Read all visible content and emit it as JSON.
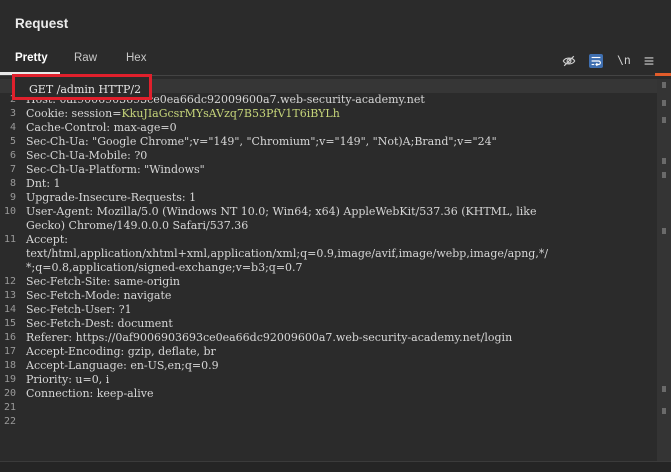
{
  "panel": {
    "title": "Request",
    "tabs": [
      {
        "label": "Pretty",
        "active": true
      },
      {
        "label": "Raw",
        "active": false
      },
      {
        "label": "Hex",
        "active": false
      }
    ],
    "toolbar": {
      "hide_icon": "eye-off-icon",
      "wrap_icon": "wrap-lines-icon",
      "newline_label": "\\n",
      "menu_icon": "hamburger-menu-icon"
    },
    "accent_color": "#e25c2a",
    "highlight_color": "#e0202c"
  },
  "request": {
    "highlighted_first_line": "GET /admin HTTP/2",
    "lines": [
      {
        "n": "1",
        "text": ""
      },
      {
        "n": "2",
        "text": "Host: 0af9006903693ce0ea66dc92009600a7.web-security-academy.net"
      },
      {
        "n": "3",
        "text": "Cookie: session=",
        "green": "KkuJIaGcsrMYsAVzq7B53PfV1T6iBYLh"
      },
      {
        "n": "4",
        "text": "Cache-Control: max-age=0"
      },
      {
        "n": "5",
        "text": "Sec-Ch-Ua: \"Google Chrome\";v=\"149\", \"Chromium\";v=\"149\", \"Not)A;Brand\";v=\"24\""
      },
      {
        "n": "6",
        "text": "Sec-Ch-Ua-Mobile: ?0"
      },
      {
        "n": "7",
        "text": "Sec-Ch-Ua-Platform: \"Windows\""
      },
      {
        "n": "8",
        "text": "Dnt: 1"
      },
      {
        "n": "9",
        "text": "Upgrade-Insecure-Requests: 1"
      },
      {
        "n": "10",
        "text": "User-Agent: Mozilla/5.0 (Windows NT 10.0; Win64; x64) AppleWebKit/537.36 (KHTML, like"
      },
      {
        "n": "",
        "text": "Gecko) Chrome/149.0.0.0 Safari/537.36"
      },
      {
        "n": "11",
        "text": "Accept:"
      },
      {
        "n": "",
        "text": "text/html,application/xhtml+xml,application/xml;q=0.9,image/avif,image/webp,image/apng,*/"
      },
      {
        "n": "",
        "text": "*;q=0.8,application/signed-exchange;v=b3;q=0.7"
      },
      {
        "n": "12",
        "text": "Sec-Fetch-Site: same-origin"
      },
      {
        "n": "13",
        "text": "Sec-Fetch-Mode: navigate"
      },
      {
        "n": "14",
        "text": "Sec-Fetch-User: ?1"
      },
      {
        "n": "15",
        "text": "Sec-Fetch-Dest: document"
      },
      {
        "n": "16",
        "text": "Referer: https://0af9006903693ce0ea66dc92009600a7.web-security-academy.net/login"
      },
      {
        "n": "17",
        "text": "Accept-Encoding: gzip, deflate, br"
      },
      {
        "n": "18",
        "text": "Accept-Language: en-US,en;q=0.9"
      },
      {
        "n": "19",
        "text": "Priority: u=0, i"
      },
      {
        "n": "20",
        "text": "Connection: keep-alive"
      },
      {
        "n": "21",
        "text": ""
      },
      {
        "n": "22",
        "text": ""
      }
    ]
  }
}
